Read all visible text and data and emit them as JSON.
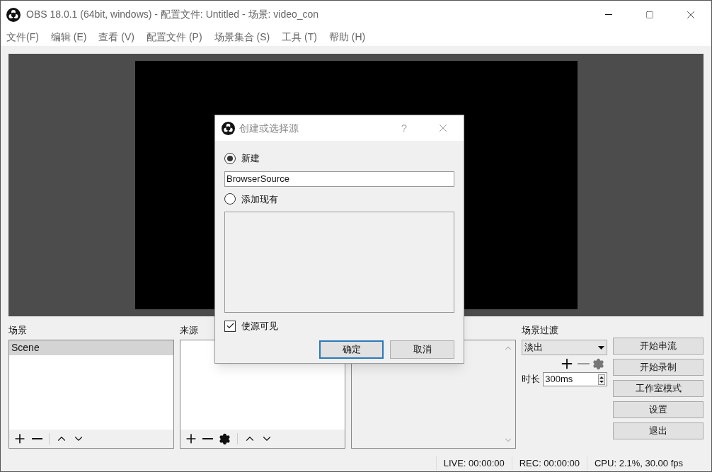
{
  "window": {
    "title": "OBS 18.0.1 (64bit, windows) - 配置文件: Untitled - 场景: video_con"
  },
  "menu": [
    "文件(F)",
    "编辑 (E)",
    "查看 (V)",
    "配置文件 (P)",
    "场景集合 (S)",
    "工具 (T)",
    "帮助 (H)"
  ],
  "scenes": {
    "title": "场景",
    "items": [
      {
        "label": "Scene",
        "selected": true
      }
    ]
  },
  "sources": {
    "title": "来源"
  },
  "transitions": {
    "title": "场景过渡",
    "value": "淡出",
    "duration_label": "时长",
    "duration": "300ms"
  },
  "controls": [
    "开始串流",
    "开始录制",
    "工作室模式",
    "设置",
    "退出"
  ],
  "status": [
    "LIVE: 00:00:00",
    "REC: 00:00:00",
    "CPU: 2.1%, 30.00 fps"
  ],
  "dialog": {
    "title": "创建或选择源",
    "help": "?",
    "options": [
      {
        "label": "新建",
        "selected": true
      },
      {
        "label": "添加现有",
        "selected": false
      }
    ],
    "name": "BrowserSource",
    "visible": {
      "label": "使源可见",
      "checked": true
    },
    "buttons": [
      {
        "label": "确定",
        "default": true
      },
      {
        "label": "取消",
        "default": false
      }
    ]
  }
}
